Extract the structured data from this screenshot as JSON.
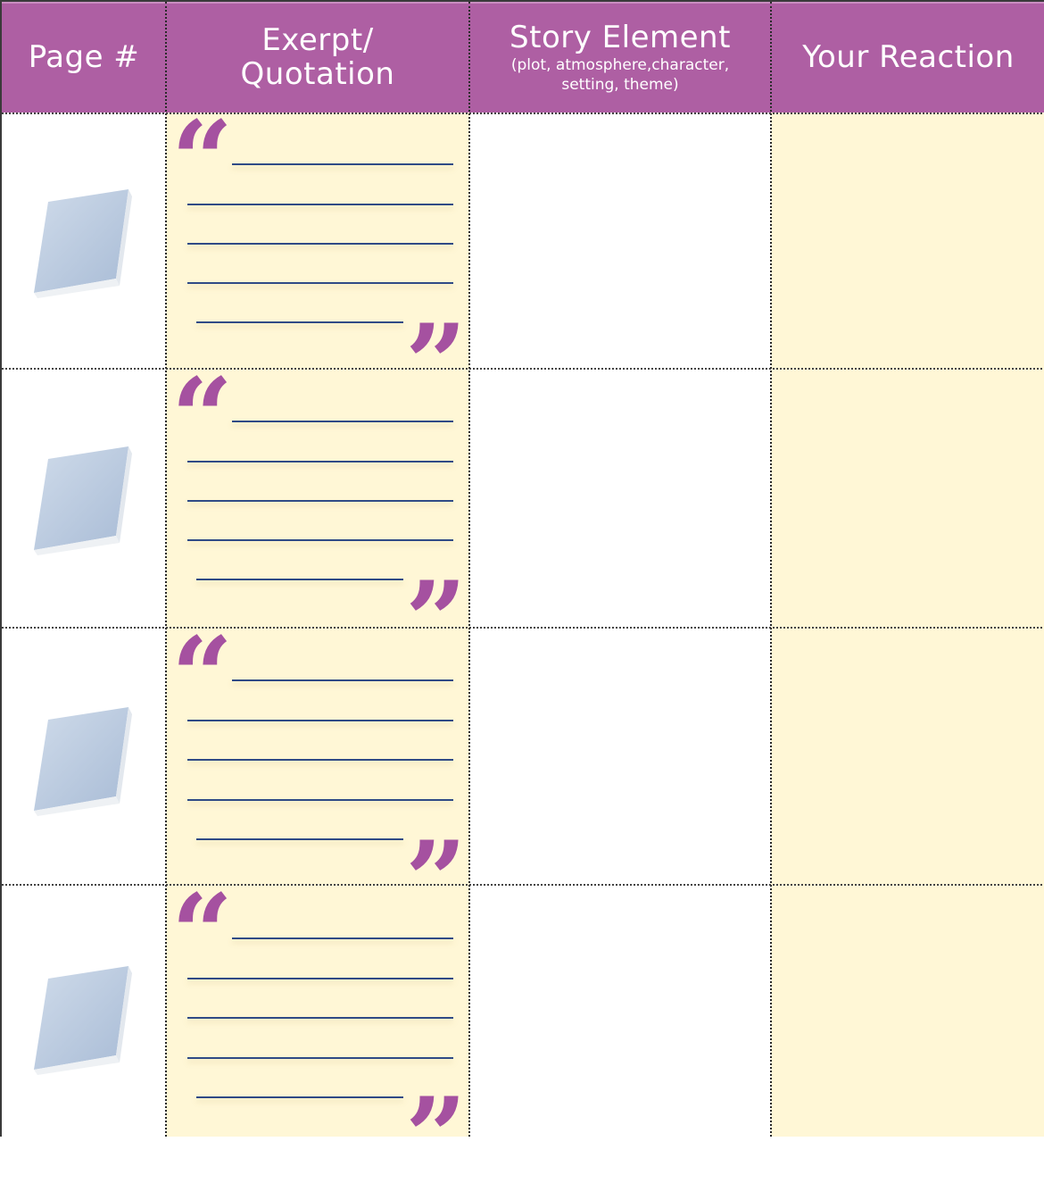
{
  "header": {
    "page_label": "Page #",
    "excerpt_label_1": "Exerpt/",
    "excerpt_label_2": "Quotation",
    "story_label": "Story Element",
    "story_sub_1": "(plot, atmosphere,character,",
    "story_sub_2": "setting, theme)",
    "reaction_label": "Your Reaction"
  },
  "colors": {
    "header_bg": "#ae5fa3",
    "quote_mark": "#a551a0",
    "cell_tint": "#fff7d6",
    "line": "#2f4a86"
  },
  "rows": [
    {
      "icon": "book-icon",
      "open_quote": "“",
      "close_quote": "”"
    },
    {
      "icon": "book-icon",
      "open_quote": "“",
      "close_quote": "”"
    },
    {
      "icon": "book-icon",
      "open_quote": "“",
      "close_quote": "”"
    },
    {
      "icon": "book-icon",
      "open_quote": "“",
      "close_quote": "”"
    }
  ]
}
